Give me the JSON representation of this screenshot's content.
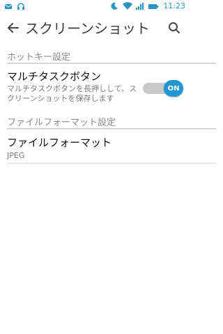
{
  "status_bar": {
    "time": "11:23",
    "left_icons": [
      "mail-icon",
      "headphones-icon"
    ],
    "right_icons": [
      "moon-icon",
      "wifi-icon",
      "signal-icon",
      "battery-icon"
    ],
    "accent": "#2a95c5"
  },
  "app_bar": {
    "title": "スクリーンショット",
    "back_icon": "back-arrow-icon",
    "search_icon": "search-icon"
  },
  "sections": [
    {
      "header": "ホットキー設定",
      "items": [
        {
          "title": "マルチタスクボタン",
          "summary": "マルチタスクボタンを長押しして、スクリーンショットを保存します",
          "toggle": {
            "label": "ON",
            "checked": true,
            "color": "#2196d3"
          }
        }
      ]
    },
    {
      "header": "ファイルフォーマット設定",
      "items": [
        {
          "title": "ファイルフォーマット",
          "value": "JPEG"
        }
      ]
    }
  ]
}
